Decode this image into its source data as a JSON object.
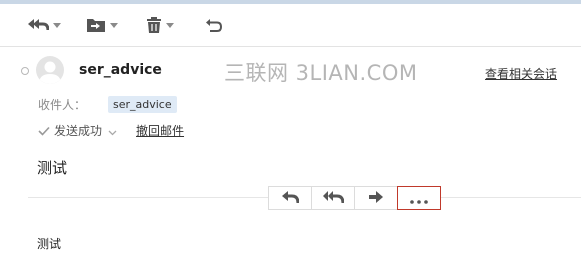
{
  "toolbar": {
    "buttons": [
      {
        "name": "reply-all",
        "icon": "reply-all-icon",
        "has_dropdown": true
      },
      {
        "name": "move",
        "icon": "move-to-folder-icon",
        "has_dropdown": true
      },
      {
        "name": "delete",
        "icon": "trash-icon",
        "has_dropdown": true
      },
      {
        "name": "back",
        "icon": "return-icon",
        "has_dropdown": false
      }
    ]
  },
  "message": {
    "sender": "ser_advice",
    "watermark": "三联网 3LIAN.COM",
    "view_related_label": "查看相关会话",
    "recipient_label": "收件人：",
    "recipient": "ser_advice",
    "status_text": "发送成功",
    "recall_label": "撤回邮件",
    "subject": "测试",
    "body": "测试"
  },
  "actions": [
    {
      "name": "reply",
      "icon": "reply-icon"
    },
    {
      "name": "reply-all",
      "icon": "reply-all-icon"
    },
    {
      "name": "forward",
      "icon": "forward-arrow-icon"
    },
    {
      "name": "more",
      "icon": "more-dots-icon",
      "highlight_color": "#c0392b"
    }
  ],
  "colors": {
    "accent_chip": "#dfeaf6",
    "icon_gray": "#555555",
    "highlight": "#c0392b"
  }
}
